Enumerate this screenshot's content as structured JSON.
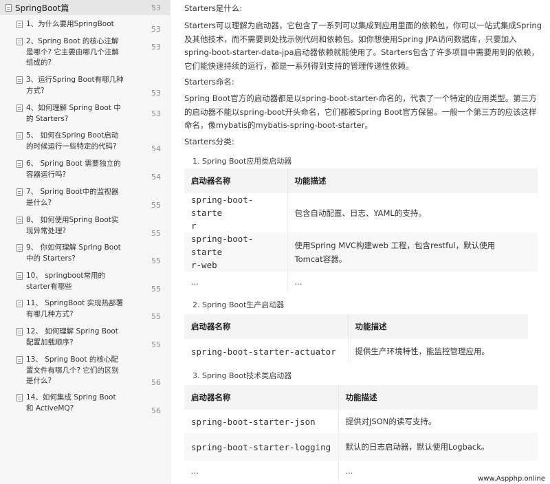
{
  "sidebar": {
    "title": "SpringBoot篇",
    "title_page": "53",
    "items": [
      {
        "label": "1、为什么要用SpringBoot",
        "page": "53"
      },
      {
        "label": "2、Spring Boot 的核心注解是哪个? 它主要由哪几个注解组成的?",
        "page": "53"
      },
      {
        "label": "3、运行Spring Boot有哪几种方式?",
        "page": "53"
      },
      {
        "label": "4、如何理解 Spring Boot 中的 Starters?",
        "page": "53"
      },
      {
        "label": "5、 如何在Spring Boot启动的时候运行一些特定的代码?",
        "page": "54"
      },
      {
        "label": "6、 Spring Boot 需要独立的容器运行吗?",
        "page": "54"
      },
      {
        "label": "7、 Spring Boot中的监视器是什么?",
        "page": "55"
      },
      {
        "label": "8、 如何使用Spring Boot实现异常处理?",
        "page": "55"
      },
      {
        "label": "9、 你如何理解 Spring Boot 中的 Starters?",
        "page": "55"
      },
      {
        "label": "10、 springboot常用的starter有哪些",
        "page": "55"
      },
      {
        "label": "11、 SpringBoot 实现热部署有哪几种方式?",
        "page": "55"
      },
      {
        "label": "12、 如何理解 Spring Boot 配置加载顺序?",
        "page": "55"
      },
      {
        "label": "13、 Spring Boot 的核心配置文件有哪几个? 它们的区别是什么?",
        "page": "56"
      },
      {
        "label": "14、如何集成 Spring Boot 和 ActiveMQ?",
        "page": "56"
      }
    ]
  },
  "content": {
    "h_what": "Starters是什么:",
    "p_what": "Starters可以理解为启动器，它包含了一系列可以集成到应用里面的依赖包，你可以一站式集成Spring及其他技术，而不需要到处找示例代码和依赖包。如你想使用Spring JPA访问数据库，只要加入spring-boot-starter-data-jpa启动器依赖就能使用了。Starters包含了许多项目中需要用到的依赖，它们能快速持续的运行，都是一系列得到支持的管理传递性依赖。",
    "h_name": "Starters命名:",
    "p_name": "Spring Boot官方的启动器都是以spring-boot-starter-命名的，代表了一个特定的应用类型。第三方的启动器不能以spring-boot开头命名，它们都被Spring Boot官方保留。一般一个第三方的应该这样命名，像mybatis的mybatis-spring-boot-starter。",
    "h_cat": "Starters分类:",
    "sec1_title": "1. Spring Boot应用类启动器",
    "sec2_title": "2. Spring Boot生产启动器",
    "sec3_title": "3. Spring Boot技术类启动器",
    "col_name": "启动器名称",
    "col_desc": "功能描述",
    "ellipsis": "...",
    "t1_r1_name_a": "spring-boot-starte",
    "t1_r1_name_b": "r",
    "t1_r1_desc": "包含自动配置、日志、YAML的支持。",
    "t1_r2_name_a": "spring-boot-starte",
    "t1_r2_name_b": "r-web",
    "t1_r2_desc_a": "使用Spring MVC构建web 工程，包含restful，默认使用",
    "t1_r2_desc_b": "Tomcat容器。",
    "t2_r1_name": "spring-boot-starter-actuator",
    "t2_r1_desc": "提供生产环境特性，能监控管理应用。",
    "t3_r1_name": "spring-boot-starter-json",
    "t3_r1_desc": "提供对JSON的读写支持。",
    "t3_r2_name": "spring-boot-starter-logging",
    "t3_r2_desc": "默认的日志启动器，默认使用Logback。"
  },
  "watermark": "www.Aspphp.online"
}
